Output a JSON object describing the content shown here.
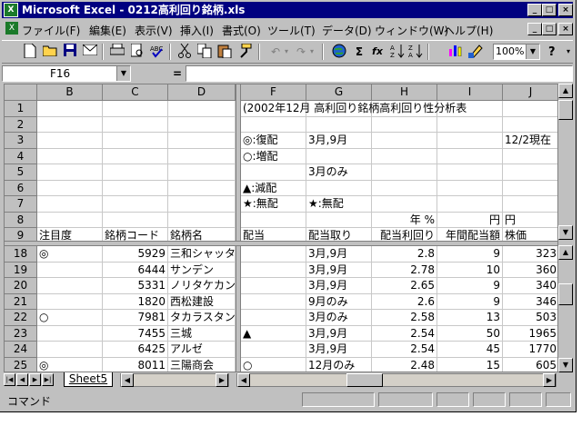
{
  "window": {
    "title": "Microsoft Excel - 0212高利回り銘柄.xls",
    "app_icon_label": "X"
  },
  "window_controls": {
    "minimize": "_",
    "maximize": "□",
    "close": "×"
  },
  "menu": [
    "ファイル(F)",
    "編集(E)",
    "表示(V)",
    "挿入(I)",
    "書式(O)",
    "ツール(T)",
    "データ(D)",
    "ウィンドウ(W)",
    "ヘルプ(H)"
  ],
  "toolbar": {
    "zoom": "100%",
    "sum": "Σ",
    "fx": "fx"
  },
  "formula_bar": {
    "cell_ref": "F16",
    "equals": "=",
    "value": ""
  },
  "columns_left": [
    "B",
    "C",
    "D"
  ],
  "columns_right": [
    "F",
    "G",
    "H",
    "I",
    "J"
  ],
  "top_rows": [
    {
      "n": "1",
      "F": "(2002年12月 高利回り銘柄高利回り性分析表",
      "G": "",
      "H": "",
      "I": "",
      "J": ""
    },
    {
      "n": "2",
      "F": "",
      "G": "",
      "H": "",
      "I": "",
      "J": ""
    },
    {
      "n": "3",
      "F": "◎:復配",
      "G": "3月,9月",
      "H": "",
      "I": "",
      "J": "12/2現在"
    },
    {
      "n": "4",
      "F": "○:増配",
      "G": "",
      "H": "",
      "I": "",
      "J": ""
    },
    {
      "n": "5",
      "F": "",
      "G": "3月のみ",
      "H": "",
      "I": "",
      "J": ""
    },
    {
      "n": "6",
      "F": "▲:減配",
      "G": "",
      "H": "",
      "I": "",
      "J": ""
    },
    {
      "n": "7",
      "F": "★:無配",
      "G": "★:無配",
      "H": "",
      "I": "",
      "J": ""
    },
    {
      "n": "8",
      "F": "",
      "G": "",
      "H": "年 %",
      "I": "円",
      "J": "円"
    },
    {
      "n": "9",
      "B": "注目度",
      "C": "銘柄コード",
      "D": "銘柄名",
      "F": "配当",
      "G": "配当取り",
      "H": "配当利回り",
      "I": "年間配当額",
      "J": "株価"
    }
  ],
  "data_rows": [
    {
      "n": "18",
      "B": "◎",
      "C": "5929",
      "D": "三和シャッター",
      "F": "",
      "G": "3月,9月",
      "H": "2.8",
      "I": "9",
      "J": "323"
    },
    {
      "n": "19",
      "B": "",
      "C": "6444",
      "D": "サンデン",
      "F": "",
      "G": "3月,9月",
      "H": "2.78",
      "I": "10",
      "J": "360"
    },
    {
      "n": "20",
      "B": "",
      "C": "5331",
      "D": "ノリタケカンパニー",
      "F": "",
      "G": "3月,9月",
      "H": "2.65",
      "I": "9",
      "J": "340"
    },
    {
      "n": "21",
      "B": "",
      "C": "1820",
      "D": "西松建設",
      "F": "",
      "G": "9月のみ",
      "H": "2.6",
      "I": "9",
      "J": "346"
    },
    {
      "n": "22",
      "B": "○",
      "C": "7981",
      "D": "タカラスタンダード",
      "F": "",
      "G": "3月のみ",
      "H": "2.58",
      "I": "13",
      "J": "503"
    },
    {
      "n": "23",
      "B": "",
      "C": "7455",
      "D": "三城",
      "F": "▲",
      "G": "3月,9月",
      "H": "2.54",
      "I": "50",
      "J": "1965"
    },
    {
      "n": "24",
      "B": "",
      "C": "6425",
      "D": "アルゼ",
      "F": "",
      "G": "3月,9月",
      "H": "2.54",
      "I": "45",
      "J": "1770"
    },
    {
      "n": "25",
      "B": "◎",
      "C": "8011",
      "D": "三陽商会",
      "F": "○",
      "G": "12月のみ",
      "H": "2.48",
      "I": "15",
      "J": "605"
    }
  ],
  "sheet_tab": "Sheet5",
  "status": {
    "mode": "コマンド"
  }
}
